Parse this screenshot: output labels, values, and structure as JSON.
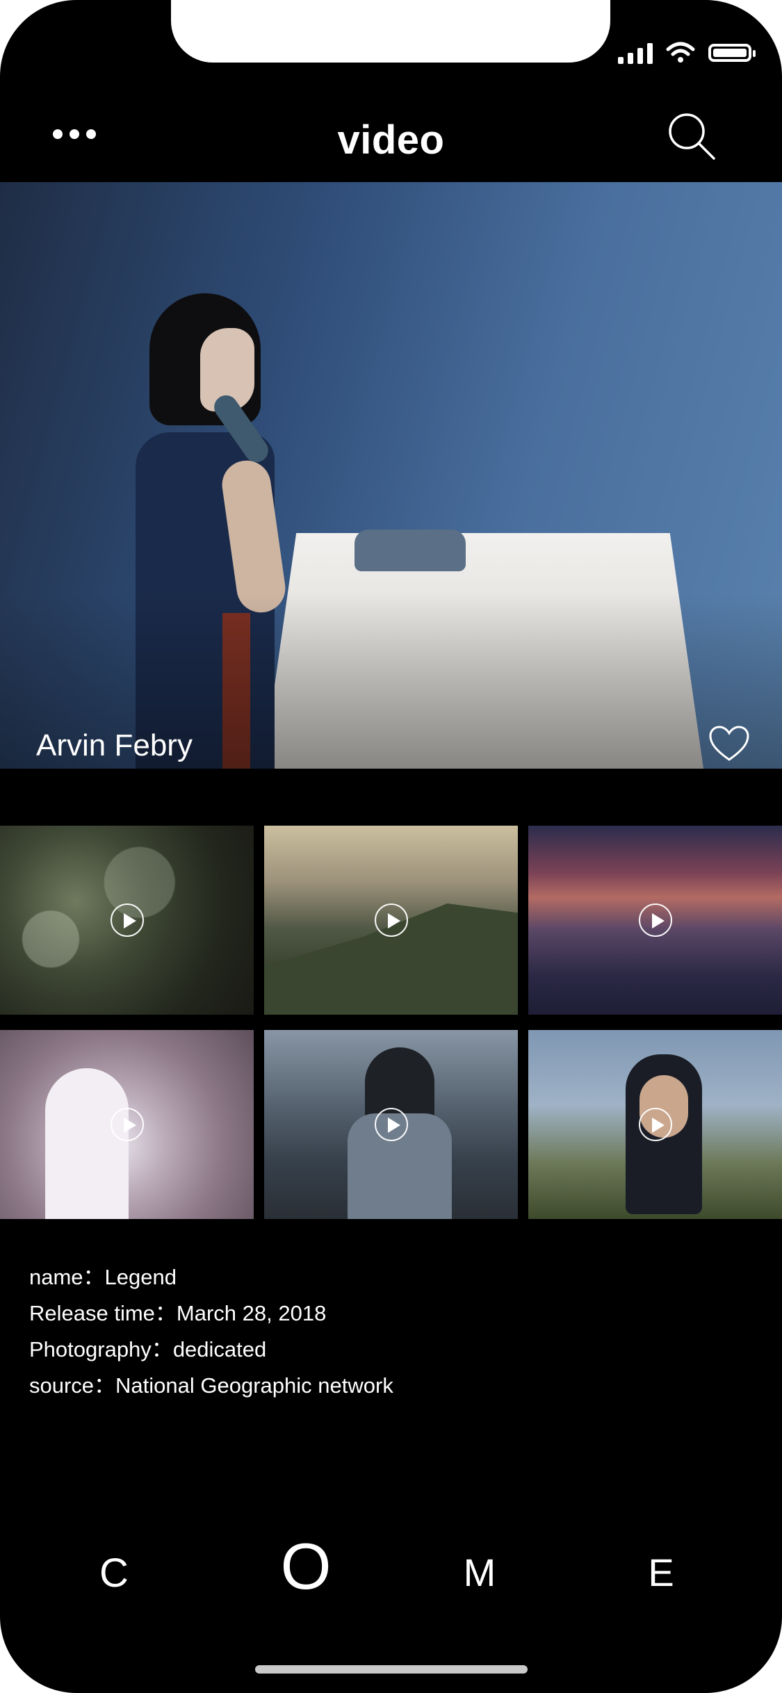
{
  "header": {
    "title": "video",
    "more_icon": "more-dots-icon",
    "search_icon": "search-icon"
  },
  "hero": {
    "caption": "Arvin Febry",
    "favorite_icon": "heart-icon"
  },
  "grid": {
    "play_icon": "play-circle-icon",
    "tile_count": 6
  },
  "info": {
    "name_label": "name：",
    "name_value": "Legend",
    "release_label": "Release time：",
    "release_value": "March 28, 2018",
    "photography_label": "Photography：",
    "photography_value": "dedicated",
    "source_label": "source：",
    "source_value": "National Geographic network"
  },
  "nav": {
    "c": "C",
    "o": "O",
    "m": "M",
    "e": "E"
  },
  "colors": {
    "background": "#000000",
    "text": "#ffffff",
    "home_indicator": "#c9c9c9"
  }
}
